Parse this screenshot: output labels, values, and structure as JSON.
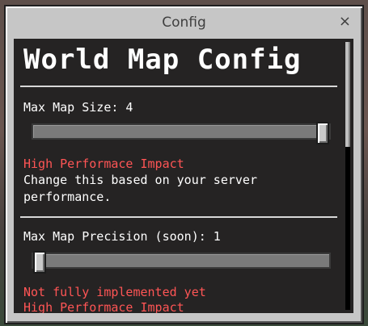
{
  "window": {
    "title": "Config",
    "close_glyph": "×"
  },
  "content": {
    "heading": "World Map Config",
    "settings": [
      {
        "label": "Max Map Size: 4",
        "value_fraction": 1.0,
        "warnings": [
          "High Performace Impact"
        ],
        "description": "Change this based on your server performance."
      },
      {
        "label": "Max Map Precision (soon): 1",
        "value_fraction": 0.0,
        "warnings": [
          "Not fully implemented yet",
          "High Performace Impact"
        ]
      }
    ]
  },
  "colors": {
    "warning": "#ff5555",
    "text": "#ffffff",
    "window": "#c6c6c6"
  },
  "icons": {
    "close": "close-icon"
  }
}
